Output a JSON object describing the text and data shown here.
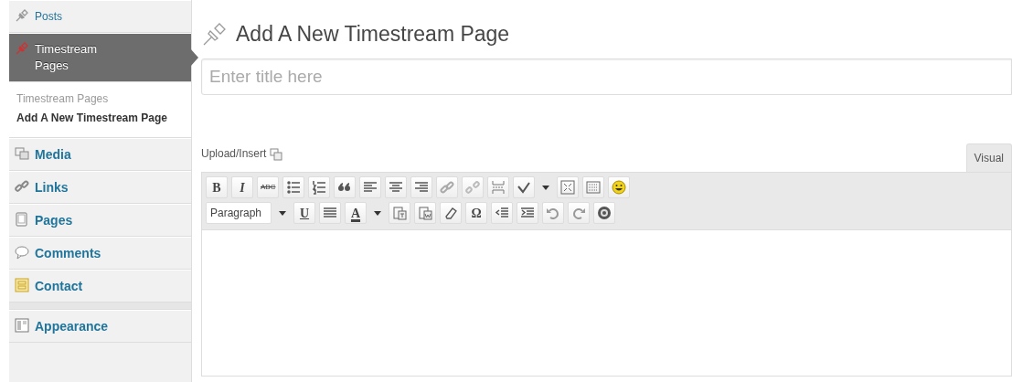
{
  "sidebar": {
    "menu": [
      {
        "label": "Posts",
        "kind": "pin",
        "selected": false
      },
      {
        "label": "Timestream Pages",
        "kind": "pin",
        "selected": true,
        "submenu": [
          {
            "label": "Timestream Pages",
            "selected": false
          },
          {
            "label": "Add A New Timestream Page",
            "selected": true
          }
        ]
      },
      {
        "label": "Media",
        "kind": "media",
        "selected": false
      },
      {
        "label": "Links",
        "kind": "links",
        "selected": false
      },
      {
        "label": "Pages",
        "kind": "pages",
        "selected": false
      },
      {
        "label": "Comments",
        "kind": "comments",
        "selected": false
      },
      {
        "label": "Contact",
        "kind": "contact",
        "selected": false
      },
      {
        "label": "Appearance",
        "kind": "appearance",
        "selected": false,
        "separator_before": true
      }
    ]
  },
  "page_title": "Add A New Timestream Page",
  "title_field": {
    "placeholder": "Enter title here"
  },
  "editor": {
    "upload_label": "Upload/Insert",
    "tabs": [
      {
        "label": "Visual",
        "selected": true
      }
    ],
    "toolbar_rows": [
      [
        {
          "kind": "bold",
          "label": "B"
        },
        {
          "kind": "italic",
          "label": "I"
        },
        {
          "kind": "strike",
          "label": "ABC"
        },
        {
          "kind": "bullets"
        },
        {
          "kind": "numbered"
        },
        {
          "kind": "quote"
        },
        {
          "kind": "align-left"
        },
        {
          "kind": "align-center"
        },
        {
          "kind": "align-right"
        },
        {
          "kind": "link"
        },
        {
          "kind": "unlink"
        },
        {
          "kind": "more"
        },
        {
          "kind": "spellcheck"
        },
        {
          "kind": "caret"
        },
        {
          "kind": "fullscreen"
        },
        {
          "kind": "kitchen"
        },
        {
          "kind": "smiley"
        }
      ],
      [
        {
          "kind": "select",
          "label": "Paragraph"
        },
        {
          "kind": "caret"
        },
        {
          "kind": "underline",
          "label": "U"
        },
        {
          "kind": "justify"
        },
        {
          "kind": "text-color",
          "label": "A"
        },
        {
          "kind": "caret"
        },
        {
          "kind": "paste-text"
        },
        {
          "kind": "paste-word"
        },
        {
          "kind": "eraser"
        },
        {
          "kind": "symbol",
          "label": "Ω"
        },
        {
          "kind": "outdent"
        },
        {
          "kind": "indent"
        },
        {
          "kind": "undo"
        },
        {
          "kind": "redo"
        },
        {
          "kind": "help"
        }
      ]
    ]
  }
}
